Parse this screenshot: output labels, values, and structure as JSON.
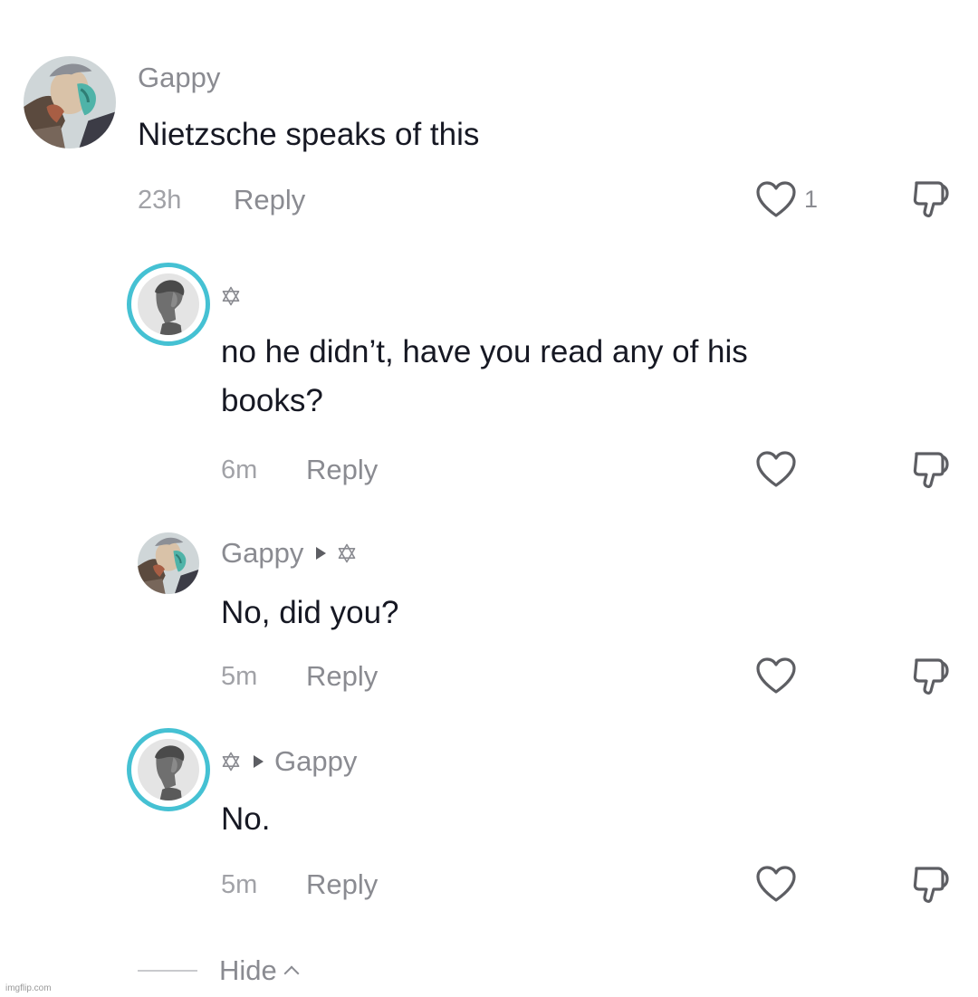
{
  "comments": [
    {
      "author": "Gappy",
      "text": "Nietzsche speaks of this",
      "time": "23h",
      "reply_label": "Reply",
      "like_count": "1"
    },
    {
      "author": "",
      "text_line1": "no he didn’t, have you read any of his",
      "text_line2": "books?",
      "time": "6m",
      "reply_label": "Reply"
    },
    {
      "author": "Gappy",
      "text": "No, did you?",
      "time": "5m",
      "reply_label": "Reply"
    },
    {
      "reply_to": "Gappy",
      "text": "No.",
      "time": "5m",
      "reply_label": "Reply"
    }
  ],
  "hide_label": "Hide",
  "watermark": "imgflip.com",
  "icons": {
    "like": "heart-outline-icon",
    "dislike": "thumbs-down-icon",
    "star": "star-of-david-icon",
    "arrow": "play-arrow-icon"
  },
  "colors": {
    "ring": "#45c1d3",
    "muted_text": "#8a8b91",
    "body_text": "#161823"
  }
}
